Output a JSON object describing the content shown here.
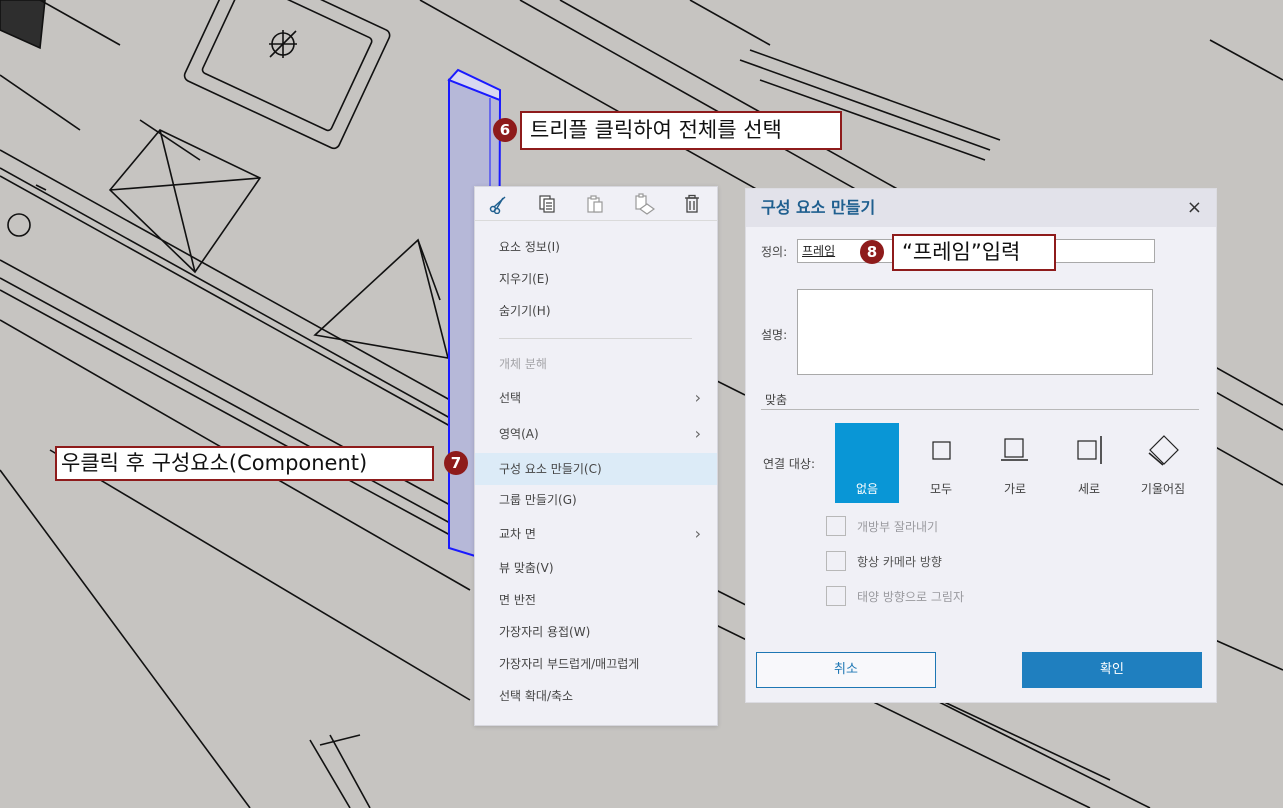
{
  "callouts": {
    "step6": {
      "number": "6",
      "text": "트리플 클릭하여 전체를 선택"
    },
    "step7": {
      "number": "7",
      "text": "우클릭 후 구성요소(Component)"
    },
    "step8": {
      "number": "8",
      "text": "“프레임”입력"
    }
  },
  "context_menu": {
    "toolbar_icons": [
      "cut-icon",
      "copy-icon",
      "paste-icon",
      "paste-in-place-icon",
      "delete-icon"
    ],
    "items": [
      {
        "label": "요소 정보(I)",
        "disabled": false,
        "submenu": false
      },
      {
        "label": "지우기(E)",
        "disabled": false,
        "submenu": false
      },
      {
        "label": "숨기기(H)",
        "disabled": false,
        "submenu": false
      },
      {
        "label": "개체 분해",
        "disabled": true,
        "submenu": false
      },
      {
        "label": "선택",
        "disabled": false,
        "submenu": true
      },
      {
        "label": "영역(A)",
        "disabled": false,
        "submenu": true
      },
      {
        "label": "구성 요소 만들기(C)",
        "disabled": false,
        "submenu": false,
        "highlighted": true
      },
      {
        "label": "그룹 만들기(G)",
        "disabled": false,
        "submenu": false
      },
      {
        "label": "교차 면",
        "disabled": false,
        "submenu": true
      },
      {
        "label": "뷰 맞춤(V)",
        "disabled": false,
        "submenu": false
      },
      {
        "label": "면 반전",
        "disabled": false,
        "submenu": false
      },
      {
        "label": "가장자리 용접(W)",
        "disabled": false,
        "submenu": false
      },
      {
        "label": "가장자리 부드럽게/매끄럽게",
        "disabled": false,
        "submenu": false
      },
      {
        "label": "선택 확대/축소",
        "disabled": false,
        "submenu": false
      }
    ]
  },
  "dialog": {
    "title": "구성 요소 만들기",
    "close": "×",
    "definition_label": "정의:",
    "definition_value": "프레임",
    "description_label": "설명:",
    "description_value": "",
    "align_section": "맞춤",
    "glue_label": "연결 대상:",
    "align_options": [
      {
        "label": "없음",
        "icon": "none-icon",
        "active": true
      },
      {
        "label": "모두",
        "icon": "all-icon",
        "active": false
      },
      {
        "label": "가로",
        "icon": "horizontal-icon",
        "active": false
      },
      {
        "label": "세로",
        "icon": "vertical-icon",
        "active": false
      },
      {
        "label": "기울어짐",
        "icon": "sloped-icon",
        "active": false
      }
    ],
    "checkboxes": [
      {
        "label": "개방부 잘라내기",
        "checked": false,
        "enabled": false
      },
      {
        "label": "항상 카메라 방향",
        "checked": false,
        "enabled": true
      },
      {
        "label": "태양 방향으로 그림자",
        "checked": false,
        "enabled": false
      }
    ],
    "cancel_label": "취소",
    "ok_label": "확인"
  },
  "colors": {
    "accent": "#1f7fbf",
    "callout_border": "#8e1b1b",
    "selection_blue": "#1a1aff",
    "background": "#c6c4c1"
  }
}
